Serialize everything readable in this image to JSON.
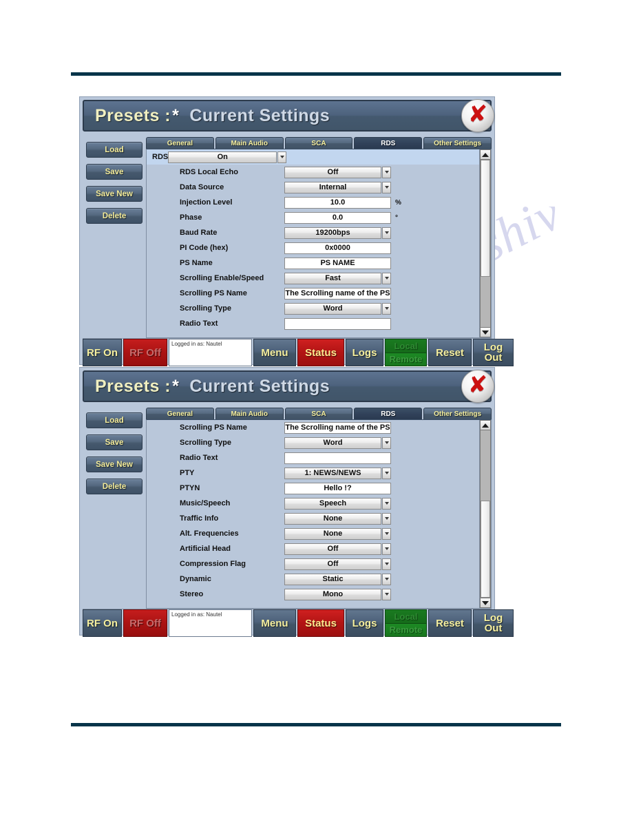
{
  "window": {
    "title_prefix": "Presets :",
    "title_star": "*",
    "title_main": "Current Settings",
    "close_icon": "close-x-icon"
  },
  "sidebar": {
    "buttons": [
      {
        "label": "Load"
      },
      {
        "label": "Save"
      },
      {
        "label": "Save New"
      },
      {
        "label": "Delete"
      }
    ]
  },
  "tabs": [
    {
      "label": "General",
      "active": false
    },
    {
      "label": "Main Audio",
      "active": false
    },
    {
      "label": "SCA",
      "active": false
    },
    {
      "label": "RDS",
      "active": true
    },
    {
      "label": "Other Settings",
      "active": false
    }
  ],
  "panel1": {
    "rows": [
      {
        "label": "RDS",
        "value": "On",
        "type": "select",
        "header": true
      },
      {
        "label": "RDS Local Echo",
        "value": "Off",
        "type": "select"
      },
      {
        "label": "Data Source",
        "value": "Internal",
        "type": "select"
      },
      {
        "label": "Injection Level",
        "value": "10.0",
        "type": "text",
        "unit": "%"
      },
      {
        "label": "Phase",
        "value": "0.0",
        "type": "text",
        "unit": "°"
      },
      {
        "label": "Baud Rate",
        "value": "19200bps",
        "type": "select"
      },
      {
        "label": "PI Code (hex)",
        "value": "0x0000",
        "type": "text"
      },
      {
        "label": "PS Name",
        "value": "PS NAME",
        "type": "text"
      },
      {
        "label": "Scrolling Enable/Speed",
        "value": "Fast",
        "type": "select"
      },
      {
        "label": "Scrolling PS Name",
        "value": "The Scrolling name of the PS",
        "type": "text"
      },
      {
        "label": "Scrolling Type",
        "value": "Word",
        "type": "select"
      },
      {
        "label": "Radio Text",
        "value": "",
        "type": "text"
      }
    ],
    "scroll": {
      "thumb_percent": 70,
      "position": "top"
    }
  },
  "panel2": {
    "rows": [
      {
        "label": "Scrolling PS Name",
        "value": "The Scrolling name of the PS",
        "type": "text"
      },
      {
        "label": "Scrolling Type",
        "value": "Word",
        "type": "select"
      },
      {
        "label": "Radio Text",
        "value": "",
        "type": "text"
      },
      {
        "label": "PTY",
        "value": "1: NEWS/NEWS",
        "type": "select"
      },
      {
        "label": "PTYN",
        "value": "Hello !?",
        "type": "text"
      },
      {
        "label": "Music/Speech",
        "value": "Speech",
        "type": "select"
      },
      {
        "label": "Traffic Info",
        "value": "None",
        "type": "select"
      },
      {
        "label": "Alt. Frequencies",
        "value": "None",
        "type": "select"
      },
      {
        "label": "Artificial Head",
        "value": "Off",
        "type": "select"
      },
      {
        "label": "Compression Flag",
        "value": "Off",
        "type": "select"
      },
      {
        "label": "Dynamic",
        "value": "Static",
        "type": "select"
      },
      {
        "label": "Stereo",
        "value": "Mono",
        "type": "select"
      }
    ],
    "scroll": {
      "thumb_percent": 58,
      "position": "bottom"
    }
  },
  "footer": {
    "rf_on": "RF On",
    "rf_off": "RF Off",
    "login_status": "Logged in as: Nautel",
    "menu": "Menu",
    "status": "Status",
    "logs": "Logs",
    "local": "Local",
    "remote": "Remote",
    "reset": "Reset",
    "log_out": "Log\nOut"
  },
  "watermark": {
    "line1": "manualshiv.com",
    "line2": "manualshiv"
  },
  "colors": {
    "accent_rule": "#063449",
    "titlebar": "#4a5f79",
    "tab_active": "#31425a",
    "button_text": "#f5ef9e",
    "status_red": "#c51d1d",
    "local_green": "#1a7a20",
    "header_row": "#c2d6ef"
  }
}
